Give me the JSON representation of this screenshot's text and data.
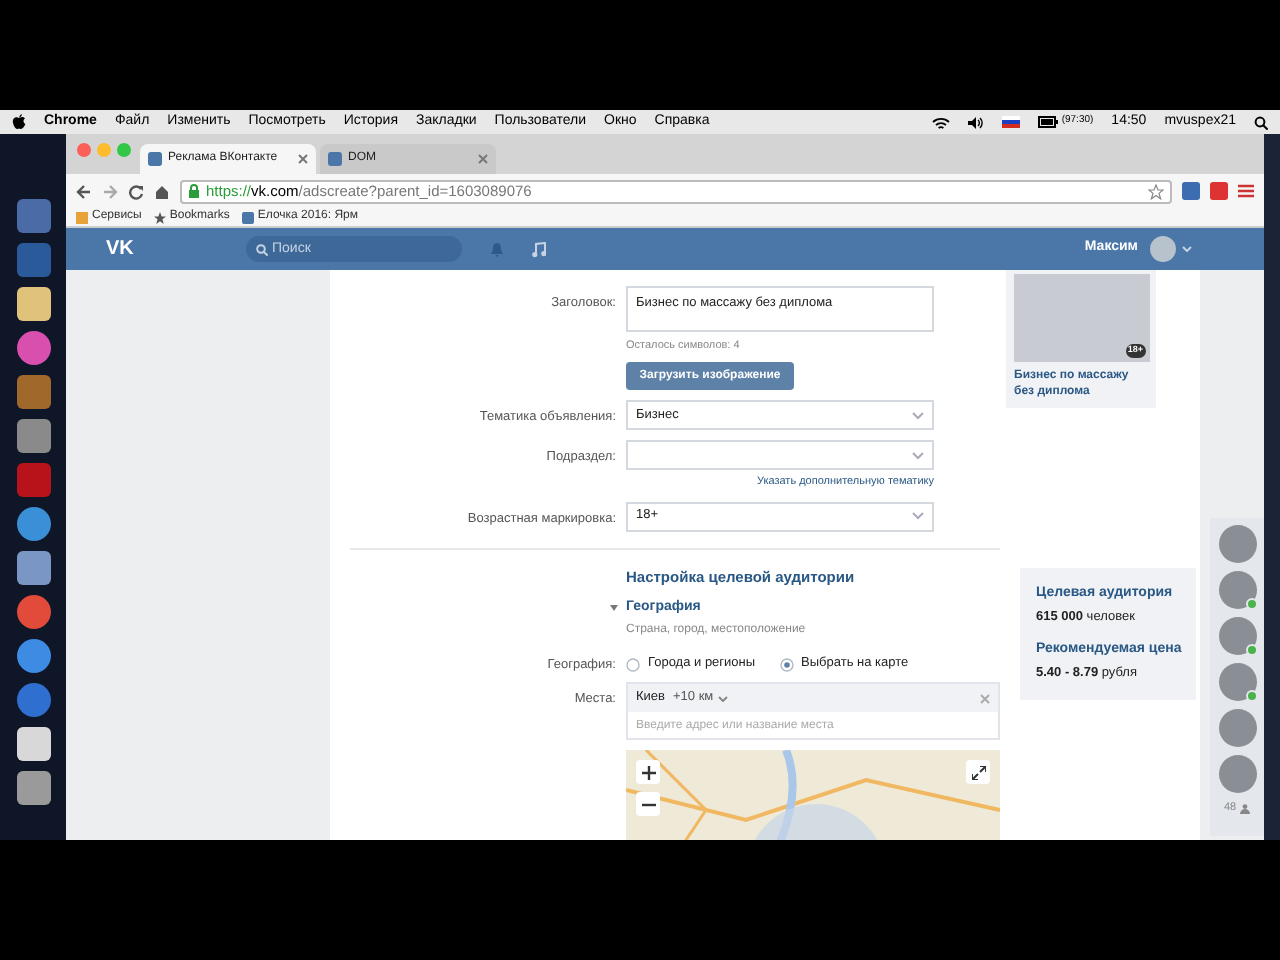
{
  "menubar": {
    "app": "Chrome",
    "menus": [
      "Файл",
      "Изменить",
      "Посмотреть",
      "История",
      "Закладки",
      "Пользователи",
      "Окно",
      "Справка"
    ],
    "battery": "(97:30)",
    "time": "14:50",
    "user": "mvuspex21"
  },
  "tabs": [
    {
      "label": "Реклама ВКонтакте",
      "selected": true
    },
    {
      "label": "DOM",
      "selected": false
    }
  ],
  "address": {
    "scheme": "https://",
    "host": "vk.com",
    "path": "/adscreate?parent_id=1603089076"
  },
  "bookmarks": [
    "Сервисы",
    "Bookmarks",
    "Елочка 2016: Ярм"
  ],
  "header": {
    "logo": "VK",
    "search_placeholder": "Поиск",
    "user_name": "Максим"
  },
  "form": {
    "title_label": "Заголовок:",
    "title_value": "Бизнес по массажу без диплома",
    "chars_left": "Осталось символов: 4",
    "upload_button": "Загрузить изображение",
    "fields": [
      {
        "kind": "select",
        "label": "Тематика объявления:",
        "value": "Бизнес"
      },
      {
        "kind": "select",
        "label": "Подраздел:"
      },
      {
        "kind": "link",
        "text": "Указать дополнительную тематику"
      },
      {
        "kind": "select",
        "label": "Возрастная маркировка:",
        "value": "18+"
      }
    ]
  },
  "audience": {
    "heading": "Настройка целевой аудитории",
    "section_title": "География",
    "expanded": true,
    "subtitle": "Страна, город, местоположение",
    "geo_label": "География:",
    "options": [
      {
        "label": "Города и регионы",
        "selected": false
      },
      {
        "label": "Выбрать на карте",
        "selected": true
      }
    ],
    "places_label": "Места:",
    "place_token": "Киев",
    "radius": "+10 км",
    "places_placeholder": "Введите адрес или название места"
  },
  "preview": {
    "caption": "Бизнес по массажу без диплома",
    "badge": "18+"
  },
  "stats": {
    "audience_label": "Целевая аудитория",
    "audience_value": "**615 000** человек",
    "price_label": "Рекомендуемая цена",
    "price_value": "**5.40 - 8.79** рубля"
  },
  "friends": {
    "items": [
      {
        "online": false
      },
      {
        "online": true
      },
      {
        "online": true
      },
      {
        "online": true
      },
      {
        "online": false
      },
      {
        "online": false
      }
    ],
    "count": "48"
  }
}
